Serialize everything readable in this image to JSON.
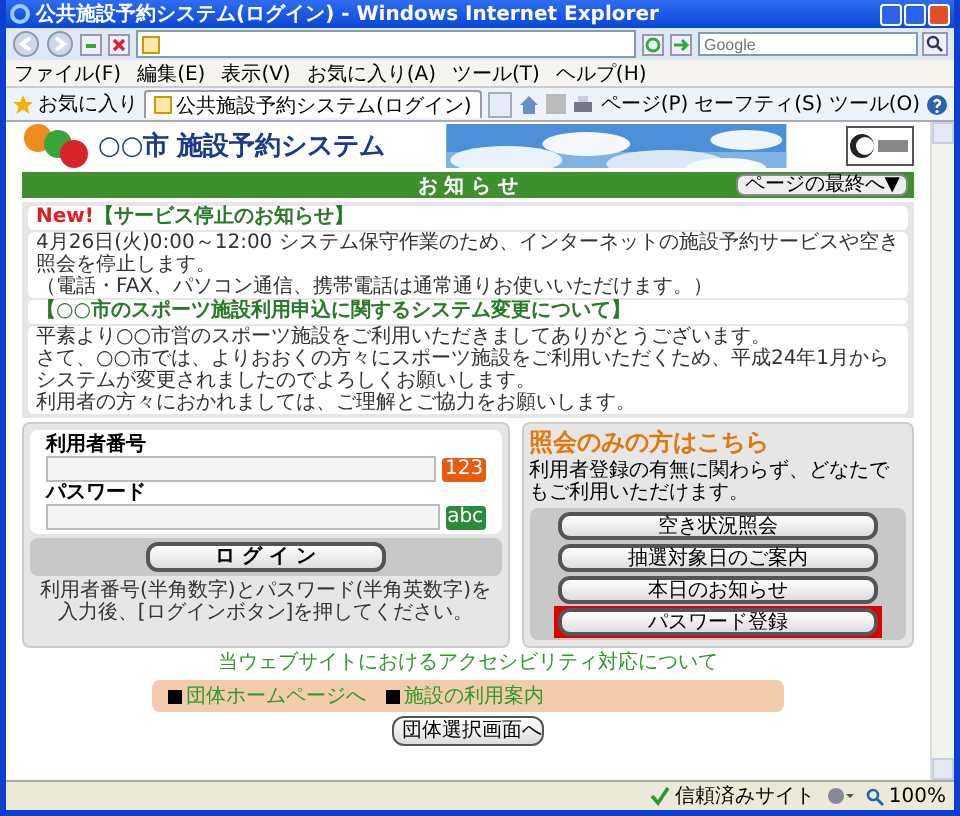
{
  "browser": {
    "title": "公共施設予約システム(ログイン) - Windows Internet Explorer",
    "search_placeholder": "Google",
    "menu": [
      "ファイル(F)",
      "編集(E)",
      "表示(V)",
      "お気に入り(A)",
      "ツール(T)",
      "ヘルプ(H)"
    ],
    "favorites": "お気に入り",
    "tabs": [
      {
        "label": "公共施設予約システム(ログイン)",
        "selected": true
      }
    ],
    "toolbar": [
      "ページ(P)",
      "セーフティ(S)",
      "ツール(O)"
    ],
    "status": {
      "zone": "信頼済みサイト",
      "zoom": "100%"
    }
  },
  "page": {
    "city": "○○市",
    "system_name": "施設予約システム",
    "notice_heading": "お 知 ら せ",
    "jump_button": "ページの最終へ▼",
    "notices": [
      {
        "badge": "New!",
        "title": "【サービス停止のお知らせ】",
        "lines": [
          "4月26日(火)0:00～12:00 システム保守作業のため、インターネットの施設予約サービスや空き照会を停止します。",
          "（電話・FAX、パソコン通信、携帯電話は通常通りお使いいただけます。）"
        ]
      },
      {
        "title": "【○○市のスポーツ施設利用申込に関するシステム変更について】",
        "lines": [
          "平素より○○市営のスポーツ施設をご利用いただきましてありがとうございます。",
          "さて、○○市では、よりおおくの方々にスポーツ施設をご利用いただくため、平成24年1月からシステムが変更されましたのでよろしくお願いします。",
          "利用者の方々におかれましては、ご理解とご協力をお願いします。"
        ]
      }
    ],
    "login": {
      "fields": [
        {
          "label": "利用者番号",
          "hint": "123",
          "kind": "number"
        },
        {
          "label": "パスワード",
          "hint": "abc",
          "kind": "text"
        }
      ],
      "button": "ロ グ イ ン",
      "note_lines": [
        "利用者番号(半角数字)とパスワード(半角英数字)を",
        "入力後、[ログインボタン]を押してください。"
      ]
    },
    "inquiry": {
      "heading": "照会のみの方はこちら",
      "description": "利用者登録の有無に関わらず、どなたでもご利用いただけます。",
      "buttons": [
        {
          "label": "空き状況照会",
          "highlighted": false
        },
        {
          "label": "抽選対象日のご案内",
          "highlighted": false
        },
        {
          "label": "本日のお知らせ",
          "highlighted": false
        },
        {
          "label": "パスワード登録",
          "highlighted": true
        }
      ]
    },
    "accessibility_link": "当ウェブサイトにおけるアクセシビリティ対応について",
    "links": [
      "団体ホームページへ",
      "施設の利用案内"
    ],
    "group_button": "団体選択画面へ"
  }
}
